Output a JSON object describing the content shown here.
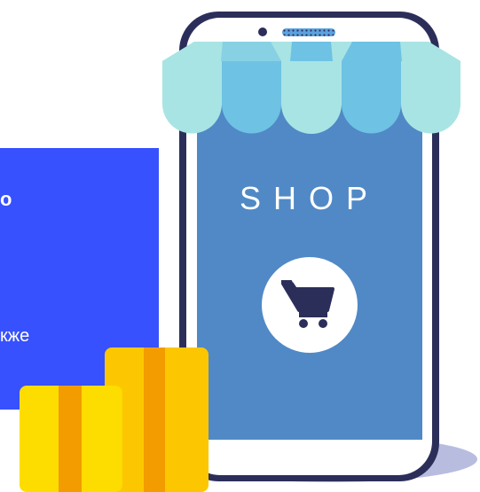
{
  "promo": {
    "line1": "о",
    "line2": "кже"
  },
  "shop": {
    "title": "SHOP",
    "cart_icon": "shopping-cart-icon"
  },
  "colors": {
    "card_blue": "#3751ff",
    "screen_blue": "#5089c6",
    "phone_frame": "#2c2e5a",
    "awning_dark": "#6ec2e4",
    "awning_light": "#a8e4e4",
    "box_yellow": "#fcc700",
    "box_stripe": "#f29c00"
  }
}
